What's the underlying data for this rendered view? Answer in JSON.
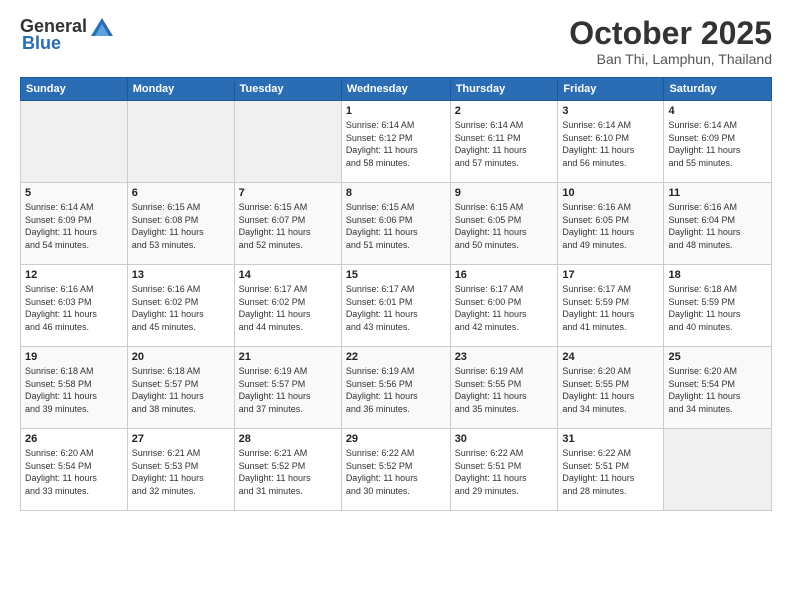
{
  "header": {
    "logo_general": "General",
    "logo_blue": "Blue",
    "month": "October 2025",
    "location": "Ban Thi, Lamphun, Thailand"
  },
  "weekdays": [
    "Sunday",
    "Monday",
    "Tuesday",
    "Wednesday",
    "Thursday",
    "Friday",
    "Saturday"
  ],
  "weeks": [
    [
      {
        "day": "",
        "info": ""
      },
      {
        "day": "",
        "info": ""
      },
      {
        "day": "",
        "info": ""
      },
      {
        "day": "1",
        "info": "Sunrise: 6:14 AM\nSunset: 6:12 PM\nDaylight: 11 hours\nand 58 minutes."
      },
      {
        "day": "2",
        "info": "Sunrise: 6:14 AM\nSunset: 6:11 PM\nDaylight: 11 hours\nand 57 minutes."
      },
      {
        "day": "3",
        "info": "Sunrise: 6:14 AM\nSunset: 6:10 PM\nDaylight: 11 hours\nand 56 minutes."
      },
      {
        "day": "4",
        "info": "Sunrise: 6:14 AM\nSunset: 6:09 PM\nDaylight: 11 hours\nand 55 minutes."
      }
    ],
    [
      {
        "day": "5",
        "info": "Sunrise: 6:14 AM\nSunset: 6:09 PM\nDaylight: 11 hours\nand 54 minutes."
      },
      {
        "day": "6",
        "info": "Sunrise: 6:15 AM\nSunset: 6:08 PM\nDaylight: 11 hours\nand 53 minutes."
      },
      {
        "day": "7",
        "info": "Sunrise: 6:15 AM\nSunset: 6:07 PM\nDaylight: 11 hours\nand 52 minutes."
      },
      {
        "day": "8",
        "info": "Sunrise: 6:15 AM\nSunset: 6:06 PM\nDaylight: 11 hours\nand 51 minutes."
      },
      {
        "day": "9",
        "info": "Sunrise: 6:15 AM\nSunset: 6:05 PM\nDaylight: 11 hours\nand 50 minutes."
      },
      {
        "day": "10",
        "info": "Sunrise: 6:16 AM\nSunset: 6:05 PM\nDaylight: 11 hours\nand 49 minutes."
      },
      {
        "day": "11",
        "info": "Sunrise: 6:16 AM\nSunset: 6:04 PM\nDaylight: 11 hours\nand 48 minutes."
      }
    ],
    [
      {
        "day": "12",
        "info": "Sunrise: 6:16 AM\nSunset: 6:03 PM\nDaylight: 11 hours\nand 46 minutes."
      },
      {
        "day": "13",
        "info": "Sunrise: 6:16 AM\nSunset: 6:02 PM\nDaylight: 11 hours\nand 45 minutes."
      },
      {
        "day": "14",
        "info": "Sunrise: 6:17 AM\nSunset: 6:02 PM\nDaylight: 11 hours\nand 44 minutes."
      },
      {
        "day": "15",
        "info": "Sunrise: 6:17 AM\nSunset: 6:01 PM\nDaylight: 11 hours\nand 43 minutes."
      },
      {
        "day": "16",
        "info": "Sunrise: 6:17 AM\nSunset: 6:00 PM\nDaylight: 11 hours\nand 42 minutes."
      },
      {
        "day": "17",
        "info": "Sunrise: 6:17 AM\nSunset: 5:59 PM\nDaylight: 11 hours\nand 41 minutes."
      },
      {
        "day": "18",
        "info": "Sunrise: 6:18 AM\nSunset: 5:59 PM\nDaylight: 11 hours\nand 40 minutes."
      }
    ],
    [
      {
        "day": "19",
        "info": "Sunrise: 6:18 AM\nSunset: 5:58 PM\nDaylight: 11 hours\nand 39 minutes."
      },
      {
        "day": "20",
        "info": "Sunrise: 6:18 AM\nSunset: 5:57 PM\nDaylight: 11 hours\nand 38 minutes."
      },
      {
        "day": "21",
        "info": "Sunrise: 6:19 AM\nSunset: 5:57 PM\nDaylight: 11 hours\nand 37 minutes."
      },
      {
        "day": "22",
        "info": "Sunrise: 6:19 AM\nSunset: 5:56 PM\nDaylight: 11 hours\nand 36 minutes."
      },
      {
        "day": "23",
        "info": "Sunrise: 6:19 AM\nSunset: 5:55 PM\nDaylight: 11 hours\nand 35 minutes."
      },
      {
        "day": "24",
        "info": "Sunrise: 6:20 AM\nSunset: 5:55 PM\nDaylight: 11 hours\nand 34 minutes."
      },
      {
        "day": "25",
        "info": "Sunrise: 6:20 AM\nSunset: 5:54 PM\nDaylight: 11 hours\nand 34 minutes."
      }
    ],
    [
      {
        "day": "26",
        "info": "Sunrise: 6:20 AM\nSunset: 5:54 PM\nDaylight: 11 hours\nand 33 minutes."
      },
      {
        "day": "27",
        "info": "Sunrise: 6:21 AM\nSunset: 5:53 PM\nDaylight: 11 hours\nand 32 minutes."
      },
      {
        "day": "28",
        "info": "Sunrise: 6:21 AM\nSunset: 5:52 PM\nDaylight: 11 hours\nand 31 minutes."
      },
      {
        "day": "29",
        "info": "Sunrise: 6:22 AM\nSunset: 5:52 PM\nDaylight: 11 hours\nand 30 minutes."
      },
      {
        "day": "30",
        "info": "Sunrise: 6:22 AM\nSunset: 5:51 PM\nDaylight: 11 hours\nand 29 minutes."
      },
      {
        "day": "31",
        "info": "Sunrise: 6:22 AM\nSunset: 5:51 PM\nDaylight: 11 hours\nand 28 minutes."
      },
      {
        "day": "",
        "info": ""
      }
    ]
  ]
}
